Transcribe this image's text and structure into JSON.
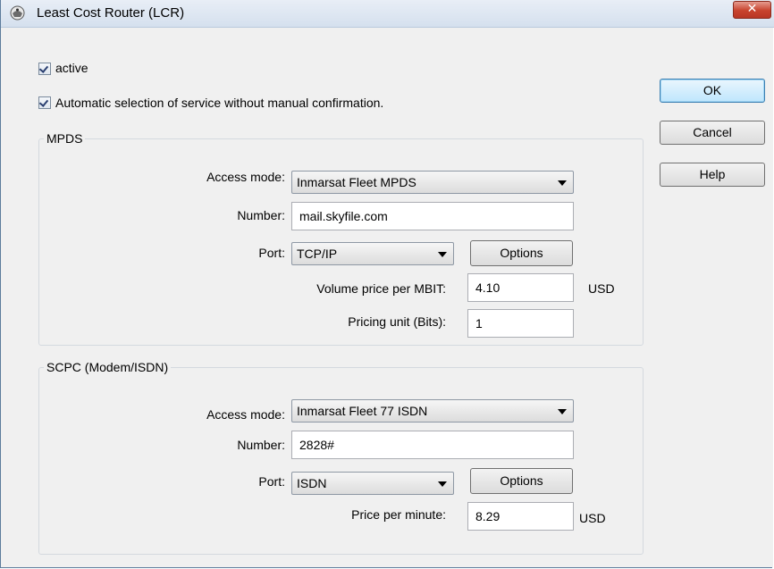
{
  "window": {
    "title": "Least Cost Router (LCR)",
    "close_label": "✕"
  },
  "options": {
    "active_label": "active",
    "active_checked": true,
    "auto_label": "Automatic selection of service without manual confirmation.",
    "auto_checked": true
  },
  "buttons": {
    "ok": "OK",
    "cancel": "Cancel",
    "help": "Help"
  },
  "mpds": {
    "group_title": "MPDS",
    "access_mode_label": "Access mode:",
    "access_mode_value": "Inmarsat Fleet MPDS",
    "number_label": "Number:",
    "number_value": "mail.skyfile.com",
    "port_label": "Port:",
    "port_value": "TCP/IP",
    "options_button": "Options",
    "volume_price_label": "Volume price per MBIT:",
    "volume_price_value": "4.10",
    "volume_price_currency": "USD",
    "pricing_unit_label": "Pricing unit (Bits):",
    "pricing_unit_value": "1"
  },
  "scpc": {
    "group_title": "SCPC (Modem/ISDN)",
    "access_mode_label": "Access mode:",
    "access_mode_value": "Inmarsat Fleet 77 ISDN",
    "number_label": "Number:",
    "number_value": "2828#",
    "port_label": "Port:",
    "port_value": "ISDN",
    "options_button": "Options",
    "price_per_minute_label": "Price per minute:",
    "price_per_minute_value": "8.29",
    "price_per_minute_currency": "USD"
  }
}
